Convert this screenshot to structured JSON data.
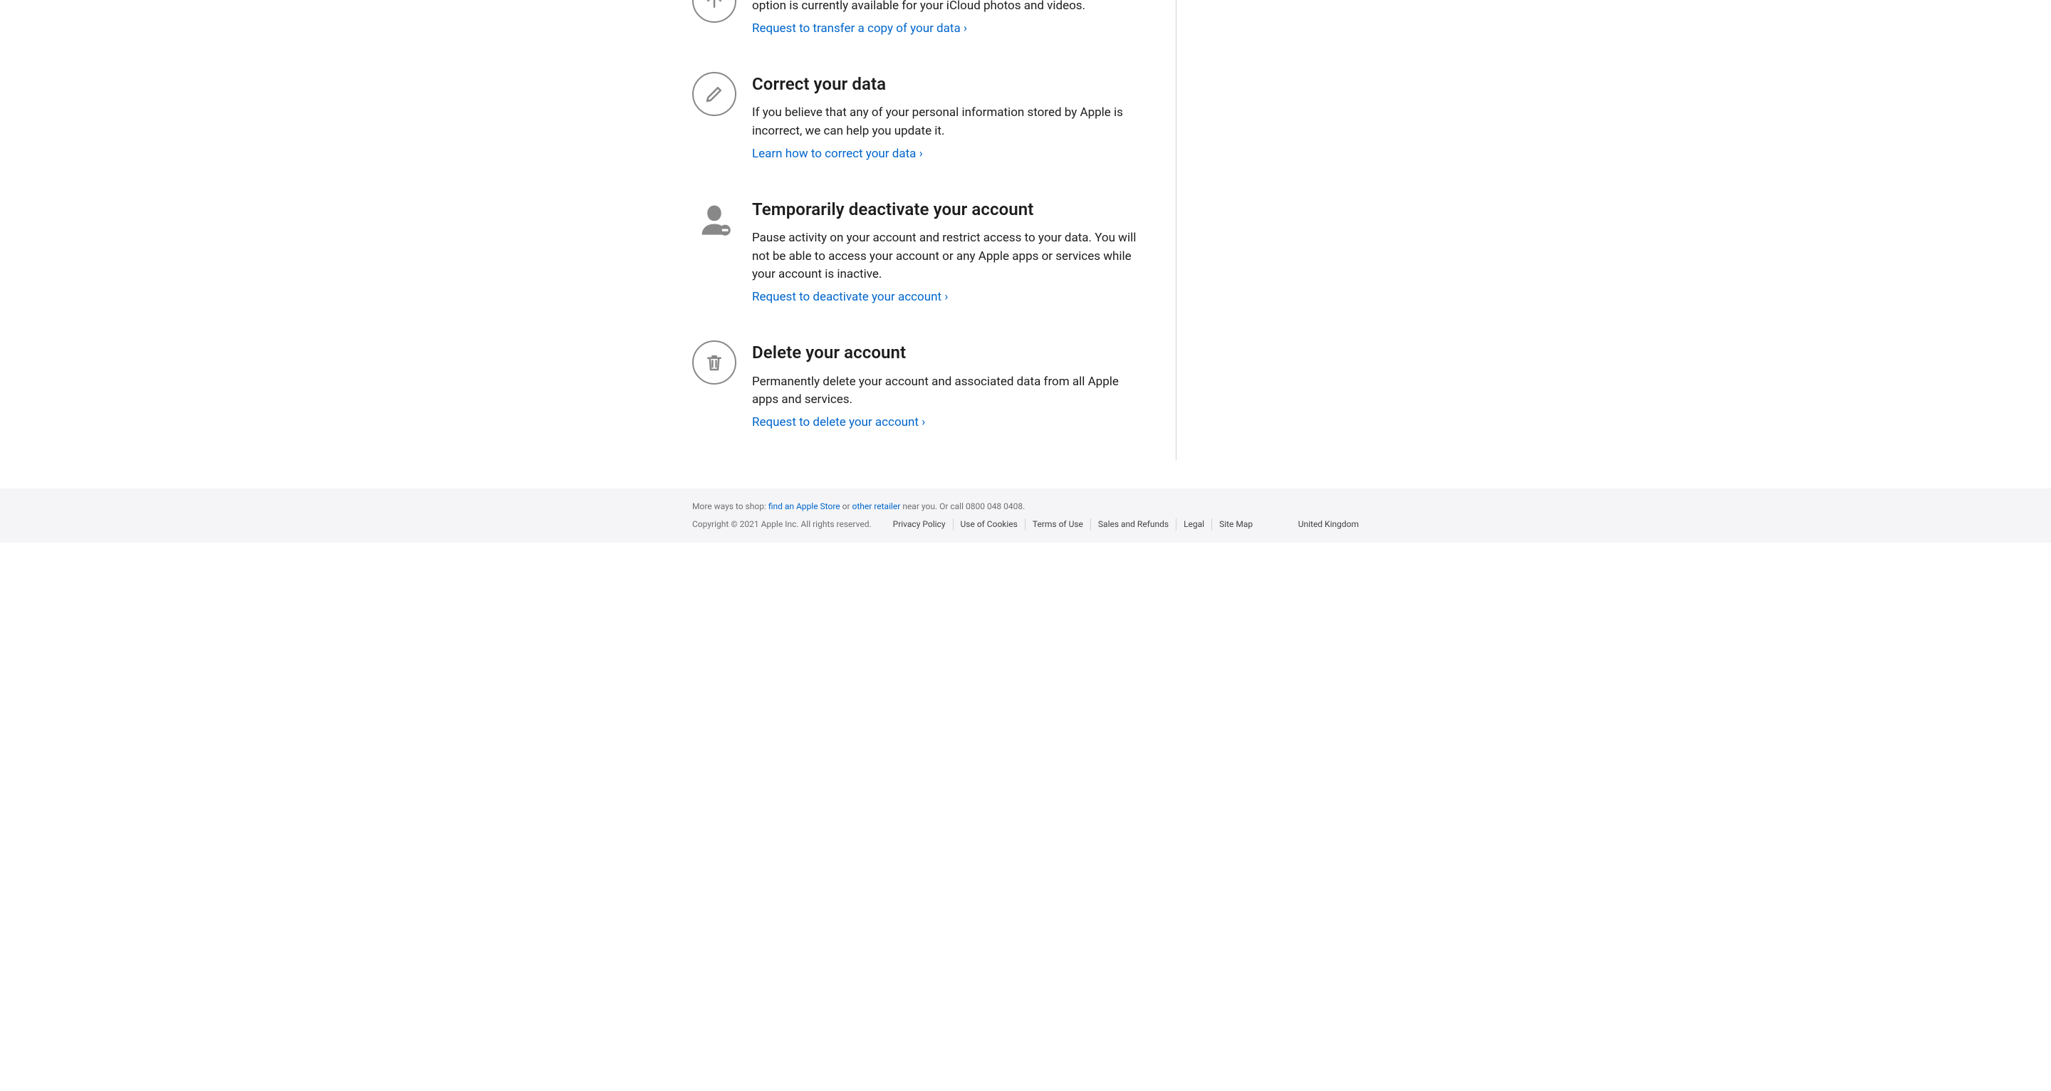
{
  "sections": {
    "transfer": {
      "title": "",
      "desc": "You can transfer a copy of your data to another participating service. This option is currently available for your iCloud photos and videos.",
      "link": "Request to transfer a copy of your data"
    },
    "correct": {
      "title": "Correct your data",
      "desc": "If you believe that any of your personal information stored by Apple is incorrect, we can help you update it.",
      "link": "Learn how to correct your data"
    },
    "deactivate": {
      "title": "Temporarily deactivate your account",
      "desc": "Pause activity on your account and restrict access to your data. You will not be able to access your account or any Apple apps or services while your account is inactive.",
      "link": "Request to deactivate your account"
    },
    "delete": {
      "title": "Delete your account",
      "desc": "Permanently delete your account and associated data from all Apple apps and services.",
      "link": "Request to delete your account"
    }
  },
  "footer": {
    "shop_prefix": "More ways to shop: ",
    "shop_link1": "find an Apple Store",
    "shop_mid": " or ",
    "shop_link2": "other retailer",
    "shop_suffix": " near you. Or call 0800 048 0408.",
    "copyright": "Copyright © 2021 Apple Inc. All rights reserved.",
    "links": {
      "privacy": "Privacy Policy",
      "cookies": "Use of Cookies",
      "terms": "Terms of Use",
      "sales": "Sales and Refunds",
      "legal": "Legal",
      "sitemap": "Site Map"
    },
    "locale": "United Kingdom"
  }
}
